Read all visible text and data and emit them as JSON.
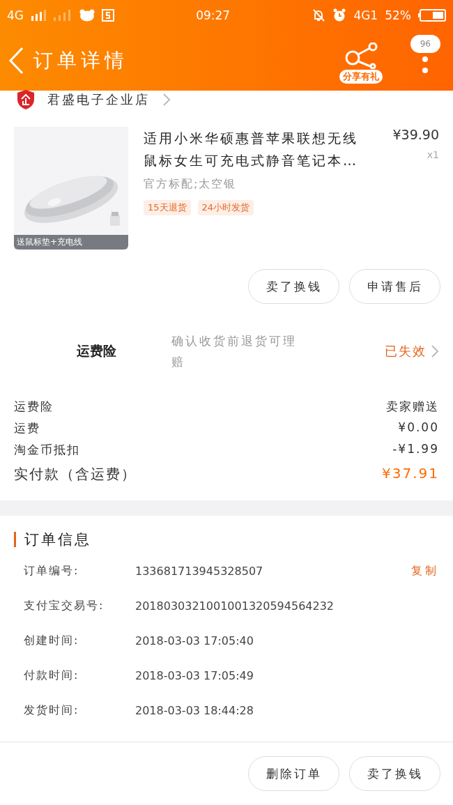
{
  "status_bar": {
    "network_left": "4G",
    "time": "09:27",
    "network_right": "4G1",
    "battery": "52%"
  },
  "header": {
    "title": "订单详情",
    "share_label": "分享有礼",
    "badge": "96"
  },
  "store": {
    "name": "君盛电子企业店"
  },
  "product": {
    "title": "适用小米华硕惠普苹果联想无线鼠标女生可充电式静音笔记本…",
    "price": "¥39.90",
    "quantity": "x1",
    "variant": "官方标配;太空银",
    "tags": [
      "15天退货",
      "24小时发货"
    ],
    "image_caption": "送鼠标垫+充电线"
  },
  "product_actions": [
    "卖了换钱",
    "申请售后"
  ],
  "insurance": {
    "label": "运费险",
    "description": "确认收货前退货可理赔",
    "status": "已失效"
  },
  "costs": [
    {
      "label": "运费险",
      "value": "卖家赠送",
      "kind": "normal"
    },
    {
      "label": "运费",
      "value": "¥0.00",
      "kind": "normal"
    },
    {
      "label": "淘金币抵扣",
      "value": "-¥1.99",
      "kind": "normal"
    },
    {
      "label": "实付款（含运费）",
      "value": "¥37.91",
      "kind": "total"
    }
  ],
  "order_info": {
    "title": "订单信息",
    "rows": [
      {
        "label": "订单编号:",
        "value": "133681713945328507",
        "action": "复制"
      },
      {
        "label": "支付宝交易号:",
        "value": "2018030321001001320594564232"
      },
      {
        "label": "创建时间:",
        "value": "2018-03-03 17:05:40"
      },
      {
        "label": "付款时间:",
        "value": "2018-03-03 17:05:49"
      },
      {
        "label": "发货时间:",
        "value": "2018-03-03 18:44:28"
      }
    ]
  },
  "bottom_actions": [
    "删除订单",
    "卖了换钱"
  ]
}
